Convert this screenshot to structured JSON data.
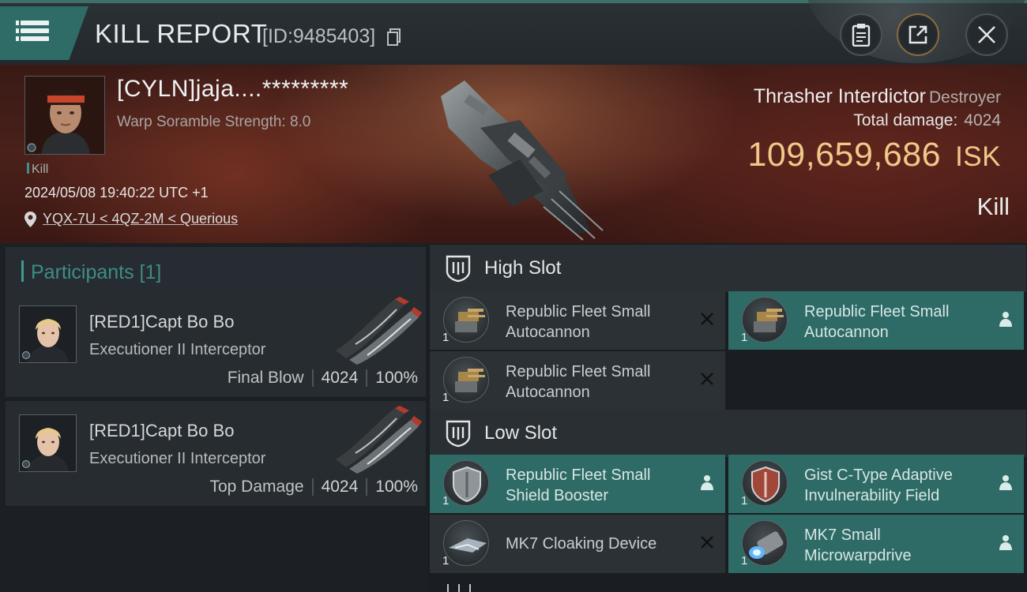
{
  "header": {
    "title": "KILL REPORT",
    "report_id": "[ID:9485403]",
    "icons": [
      "menu-icon",
      "copy-icon",
      "clipboard-icon",
      "share-icon",
      "close-icon"
    ]
  },
  "victim": {
    "name": "[CYLN]jaja....*********",
    "scramble": "Warp Soramble Strength: 8.0",
    "kill_tag": "Kill",
    "datetime": "2024/05/08 19:40:22 UTC +1",
    "location": "YQX-7U < 4QZ-2M < Querious",
    "ship_name": "Thrasher Interdictor",
    "ship_class": "Destroyer",
    "total_damage_label": "Total damage:",
    "total_damage": "4024",
    "isk_value": "109,659,686",
    "isk_unit": "ISK",
    "result": "Kill"
  },
  "participants": {
    "label": "Participants [1]",
    "items": [
      {
        "name": "[RED1]Capt Bo Bo",
        "ship": "Executioner II Interceptor",
        "desc": "Final Blow",
        "damage": "4024",
        "percent": "100%"
      },
      {
        "name": "[RED1]Capt Bo Bo",
        "ship": "Executioner II Interceptor",
        "desc": "Top Damage",
        "damage": "4024",
        "percent": "100%"
      }
    ]
  },
  "fitting": {
    "high_slot_label": "High Slot",
    "low_slot_label": "Low Slot",
    "high": [
      {
        "line1": "Republic Fleet Small",
        "line2": "Autocannon",
        "qty": "1",
        "status": "destroyed"
      },
      {
        "line1": "Republic Fleet Small",
        "line2": "Autocannon",
        "qty": "1",
        "status": "dropped"
      },
      {
        "line1": "Republic Fleet Small",
        "line2": "Autocannon",
        "qty": "1",
        "status": "destroyed"
      }
    ],
    "low": [
      {
        "line1": "Republic Fleet Small",
        "line2": "Shield Booster",
        "qty": "1",
        "status": "dropped"
      },
      {
        "line1": "Gist C-Type Adaptive",
        "line2": "Invulnerability Field",
        "qty": "1",
        "status": "dropped"
      },
      {
        "line1": "MK7 Cloaking Device",
        "line2": "",
        "qty": "1",
        "status": "destroyed"
      },
      {
        "line1": "MK7 Small",
        "line2": "Microwarpdrive",
        "qty": "1",
        "status": "dropped"
      }
    ]
  },
  "colors": {
    "accent_teal": "#2e6b66",
    "isk_gold": "#f0c98a",
    "panel": "#2b3135"
  }
}
